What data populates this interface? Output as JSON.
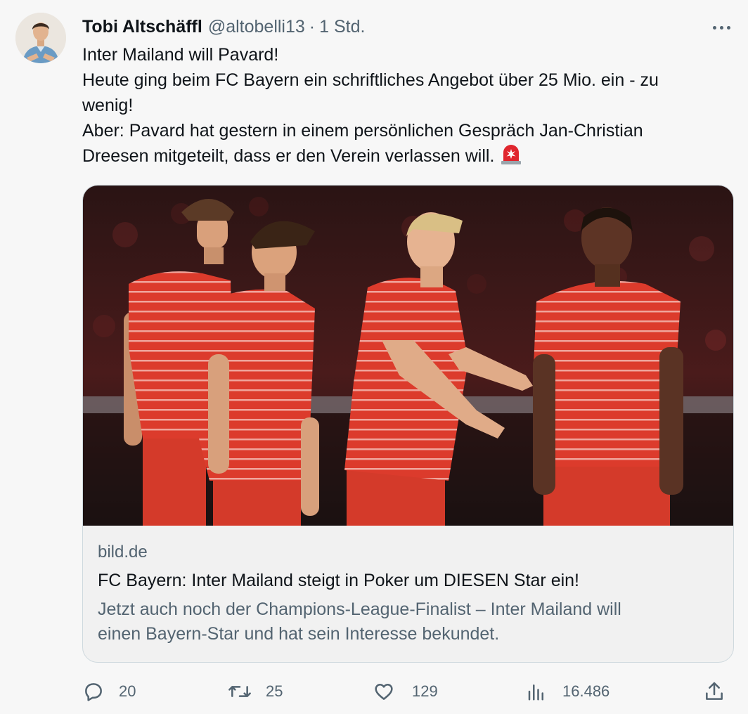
{
  "tweet": {
    "author_name": "Tobi Altschäffl",
    "handle": "@altobelli13",
    "separator": "·",
    "time": "1 Std.",
    "text_lines": [
      "Inter Mailand will Pavard!",
      "Heute ging beim FC Bayern ein schriftliches Angebot über 25 Mio. ein - zu",
      "wenig!",
      "Aber: Pavard hat gestern in einem persönlichen Gespräch Jan-Christian",
      "Dreesen mitgeteilt, dass er den Verein verlassen will."
    ],
    "emoji_icon": "rotating-light-icon"
  },
  "card": {
    "domain": "bild.de",
    "title": "FC Bayern: Inter Mailand steigt in Poker um DIESEN Star ein!",
    "description_lines": [
      "Jetzt auch noch der Champions-League-Finalist – Inter Mailand will",
      "einen Bayern-Star und hat sein Interesse bekundet."
    ]
  },
  "actions": {
    "replies": "20",
    "retweets": "25",
    "likes": "129",
    "views": "16.486"
  },
  "icons": [
    "more-icon",
    "reply-icon",
    "retweet-icon",
    "like-icon",
    "views-icon",
    "share-icon"
  ],
  "colors": {
    "text": "#0f1419",
    "secondary": "#536471",
    "jersey_red": "#dc3b2c",
    "border": "#cfd9de"
  }
}
